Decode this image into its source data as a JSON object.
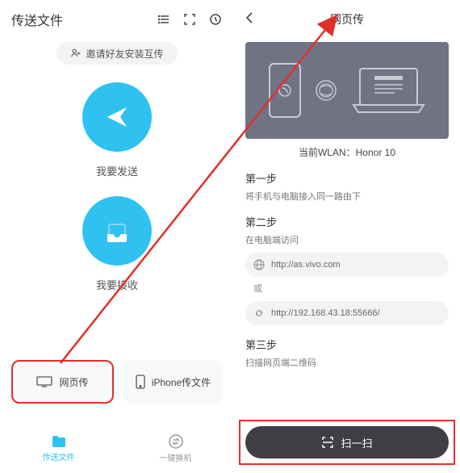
{
  "left": {
    "title": "传送文件",
    "invite": "邀请好友安装互传",
    "send_label": "我要发送",
    "recv_label": "我要接收",
    "card_web": "网页传",
    "card_iphone": "iPhone传文件",
    "nav_transfer": "传送文件",
    "nav_switch": "一键换机"
  },
  "right": {
    "title": "网页传",
    "wlan_prefix": "当前WLAN：",
    "wlan_name": "Honor 10",
    "step1_title": "第一步",
    "step1_desc": "将手机与电脑接入同一路由下",
    "step2_title": "第二步",
    "step2_desc": "在电脑端访问",
    "url1": "http://as.vivo.com",
    "or": "或",
    "url2": "http://192.168.43.18:55666/",
    "step3_title": "第三步",
    "step3_desc": "扫描网页端二维码",
    "scan_btn": "扫一扫"
  }
}
